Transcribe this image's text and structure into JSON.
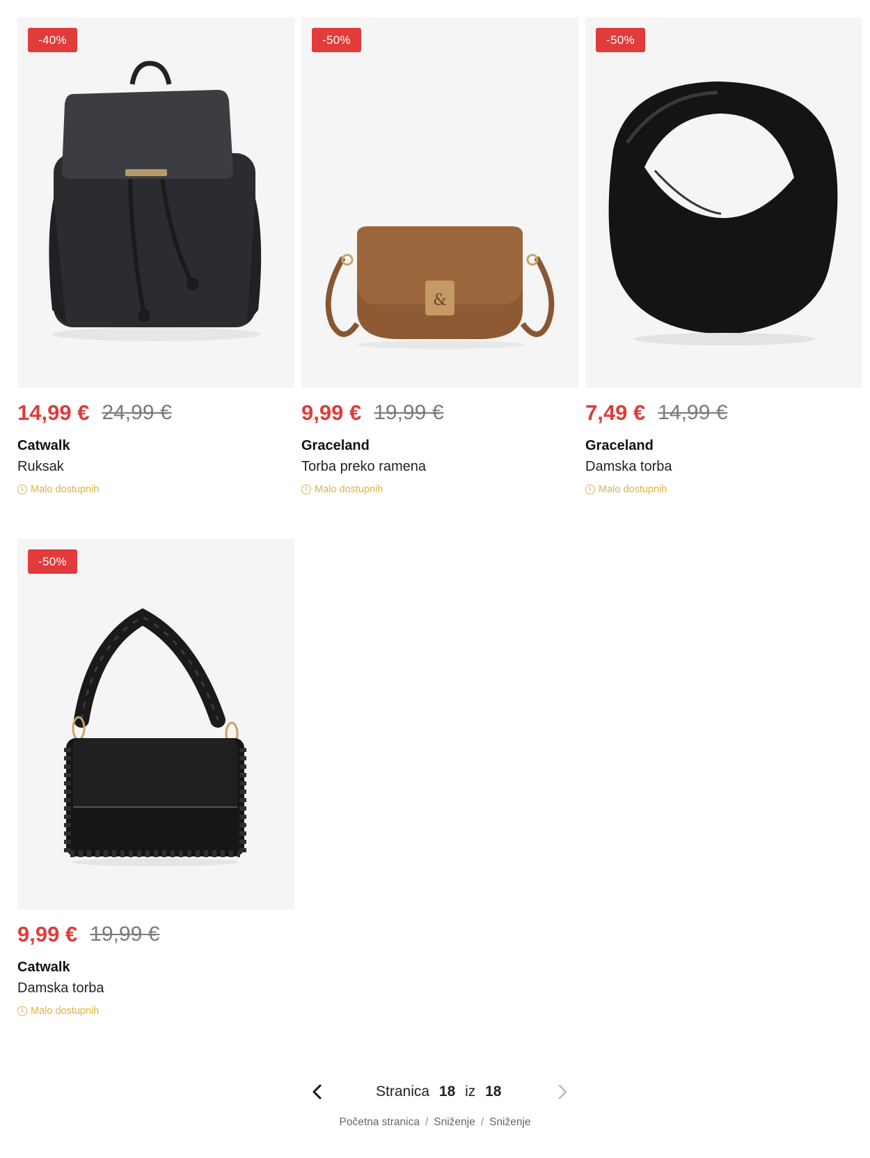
{
  "products": [
    {
      "badge": "-40%",
      "price": "14,99 €",
      "old_price": "24,99 €",
      "brand": "Catwalk",
      "name": "Ruksak",
      "availability": "Malo dostupnih",
      "icon": "backpack-image"
    },
    {
      "badge": "-50%",
      "price": "9,99 €",
      "old_price": "19,99 €",
      "brand": "Graceland",
      "name": "Torba preko ramena",
      "availability": "Malo dostupnih",
      "icon": "crossbody-bag-image"
    },
    {
      "badge": "-50%",
      "price": "7,49 €",
      "old_price": "14,99 €",
      "brand": "Graceland",
      "name": "Damska torba",
      "availability": "Malo dostupnih",
      "icon": "hobo-bag-image"
    },
    {
      "badge": "-50%",
      "price": "9,99 €",
      "old_price": "19,99 €",
      "brand": "Catwalk",
      "name": "Damska torba",
      "availability": "Malo dostupnih",
      "icon": "shoulder-bag-image"
    }
  ],
  "pagination": {
    "label": "Stranica",
    "current": "18",
    "of": "iz",
    "total": "18"
  },
  "breadcrumb": [
    "Početna stranica",
    "Sniženje",
    "Sniženje"
  ],
  "colors": {
    "sale": "#e03b3b",
    "availability": "#e2b23a",
    "card_bg": "#f5f5f5"
  }
}
